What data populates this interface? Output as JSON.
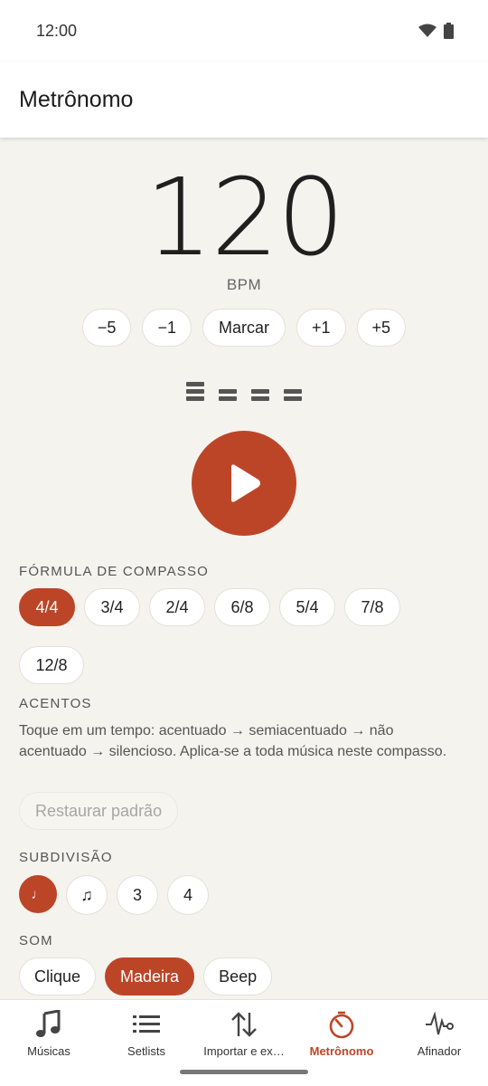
{
  "status_bar": {
    "time": "12:00"
  },
  "app_bar": {
    "title": "Metrônomo"
  },
  "tempo": {
    "bpm": "120",
    "unit": "BPM",
    "buttons": [
      "−5",
      "−1",
      "Marcar",
      "+1",
      "+5"
    ]
  },
  "beats": {
    "count": 4,
    "levels": [
      "accent",
      "normal",
      "normal",
      "normal"
    ]
  },
  "time_signature": {
    "title": "FÓRMULA DE COMPASSO",
    "options": [
      "4/4",
      "3/4",
      "2/4",
      "6/8",
      "5/4",
      "7/8",
      "12/8"
    ],
    "selected": "4/4"
  },
  "accents": {
    "title": "ACENTOS",
    "description": "Toque em um tempo: acentuado → semiacentuado → não acentuado → silencioso. Aplica-se a toda música neste compasso.",
    "restore_label": "Restaurar padrão"
  },
  "subdivision": {
    "title": "SUBDIVISÃO",
    "options": [
      "♩",
      "♫",
      "3",
      "4"
    ],
    "selected": "♩"
  },
  "sound": {
    "title": "SOM",
    "options": [
      "Clique",
      "Madeira",
      "Beep"
    ],
    "selected": "Madeira"
  },
  "bottom_nav": {
    "items": [
      {
        "label": "Músicas",
        "icon": "music-note-icon"
      },
      {
        "label": "Setlists",
        "icon": "list-icon"
      },
      {
        "label": "Importar e ex…",
        "icon": "import-export-icon"
      },
      {
        "label": "Metrônomo",
        "icon": "metronome-icon"
      },
      {
        "label": "Afinador",
        "icon": "tuner-icon"
      }
    ],
    "active": "Metrônomo"
  },
  "colors": {
    "accent": "#bd4527",
    "background": "#f5f3ee",
    "surface": "#ffffff"
  }
}
